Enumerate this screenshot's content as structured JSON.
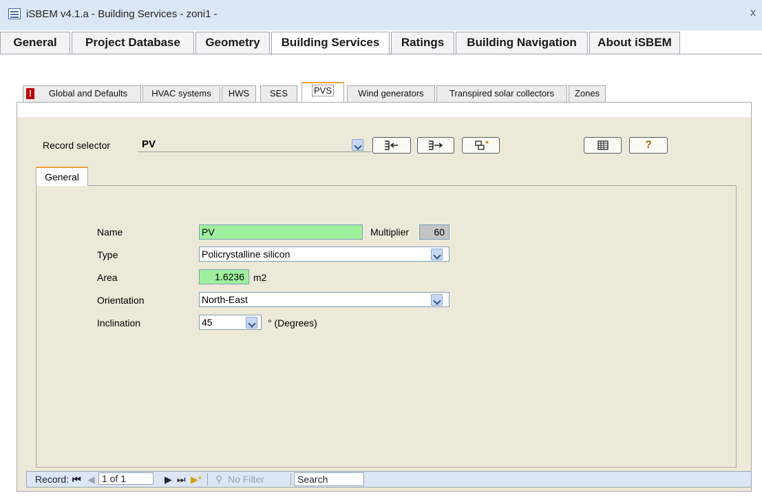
{
  "window": {
    "title": "iSBEM v4.1.a - Building Services - zoni1 -",
    "close_glyph": "x"
  },
  "main_tabs": [
    {
      "label": "General"
    },
    {
      "label": "Project Database"
    },
    {
      "label": "Geometry"
    },
    {
      "label": "Building Services"
    },
    {
      "label": "Ratings"
    },
    {
      "label": "Building Navigation"
    },
    {
      "label": "About iSBEM"
    }
  ],
  "main_tabs_active": "Building Services",
  "sub_tabs": [
    {
      "label": "Global and Defaults"
    },
    {
      "label": "HVAC systems"
    },
    {
      "label": "HWS"
    },
    {
      "label": "SES"
    },
    {
      "label": "PVS"
    },
    {
      "label": "Wind generators"
    },
    {
      "label": "Transpired solar collectors"
    },
    {
      "label": "Zones"
    }
  ],
  "sub_tabs_active": "PVS",
  "record_selector": {
    "label": "Record selector",
    "value": "PV"
  },
  "toolbar_icons": [
    "add-record-icon",
    "next-record-icon",
    "copy-record-icon",
    "table-icon",
    "help-icon"
  ],
  "inner_tab": {
    "label": "General"
  },
  "form": {
    "name": {
      "label": "Name",
      "value": "PV"
    },
    "multiplier": {
      "label": "Multiplier",
      "value": "60"
    },
    "type": {
      "label": "Type",
      "value": "Policrystalline silicon"
    },
    "area": {
      "label": "Area",
      "value": "1.6236",
      "unit": "m2"
    },
    "orientation": {
      "label": "Orientation",
      "value": "North-East"
    },
    "inclination": {
      "label": "Inclination",
      "value": "45",
      "unit": "° (Degrees)"
    }
  },
  "record_nav": {
    "label": "Record:",
    "position": "1 of 1",
    "filter": "No Filter",
    "search": "Search"
  },
  "colors": {
    "accent_tab": "#f0a030",
    "field_green": "#9ef09e",
    "panel_bg": "#ece9d8"
  }
}
